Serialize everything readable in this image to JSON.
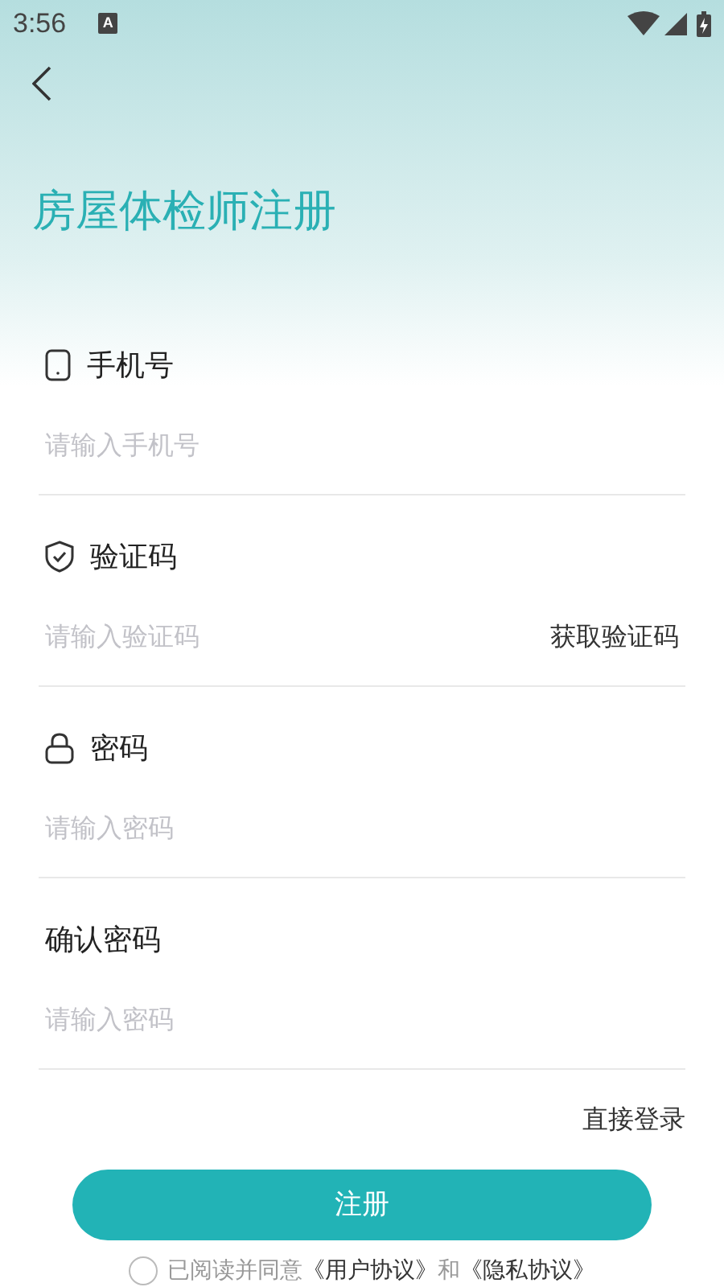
{
  "status_bar": {
    "time": "3:56",
    "indicator": "A"
  },
  "title": "房屋体检师注册",
  "fields": [
    {
      "kind": "phone",
      "label": "手机号",
      "placeholder": "请输入手机号"
    },
    {
      "kind": "code",
      "label": "验证码",
      "placeholder": "请输入验证码",
      "action": "获取验证码"
    },
    {
      "kind": "password",
      "label": "密码",
      "placeholder": "请输入密码"
    },
    {
      "kind": "confirm",
      "label": "确认密码",
      "placeholder": "请输入密码"
    }
  ],
  "login_link": "直接登录",
  "submit_button": "注册",
  "agreement": {
    "checked": false,
    "text": "已阅读并同意",
    "links": [
      "《用户协议》",
      "《隐私协议》"
    ],
    "joiner": "和"
  }
}
